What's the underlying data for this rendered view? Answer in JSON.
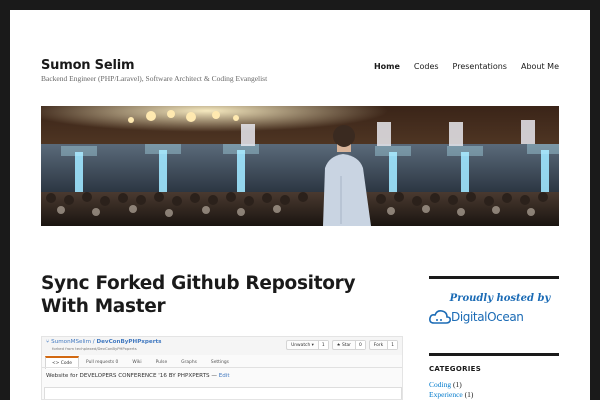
{
  "site": {
    "title": "Sumon Selim",
    "description": "Backend Engineer (PHP/Laravel), Software Architect & Coding Evangelist"
  },
  "nav": {
    "items": [
      {
        "label": "Home",
        "active": true
      },
      {
        "label": "Codes",
        "active": false
      },
      {
        "label": "Presentations",
        "active": false
      },
      {
        "label": "About Me",
        "active": false
      }
    ]
  },
  "post": {
    "title": "Sync Forked Github Repository With Master"
  },
  "github": {
    "owner": "SumonMSelim",
    "repo": "DevConByPHPxperts",
    "forked_from": "forked from techplexed/DevConByPHPxperts",
    "buttons": [
      {
        "label": "Unwatch ▾",
        "count": "1"
      },
      {
        "label": "★ Star",
        "count": "0"
      },
      {
        "label": "Fork",
        "count": "1"
      }
    ],
    "tabs": [
      "<> Code",
      "Pull requests 0",
      "Wiki",
      "Pulse",
      "Graphs",
      "Settings"
    ],
    "description": "Website for DEVELOPERS CONFERENCE '16 BY PHPXPERTS",
    "edit_label": "Edit"
  },
  "sidebar": {
    "hosted": {
      "tagline": "Proudly hosted by",
      "brand": "DigitalOcean"
    },
    "categories": {
      "title": "CATEGORIES",
      "items": [
        {
          "name": "Coding",
          "count": "(1)"
        },
        {
          "name": "Experience",
          "count": "(1)"
        }
      ]
    }
  },
  "colors": {
    "accent_link": "#007acc",
    "digitalocean_blue": "#1b6bb5",
    "page_border": "#1a1a1a"
  }
}
